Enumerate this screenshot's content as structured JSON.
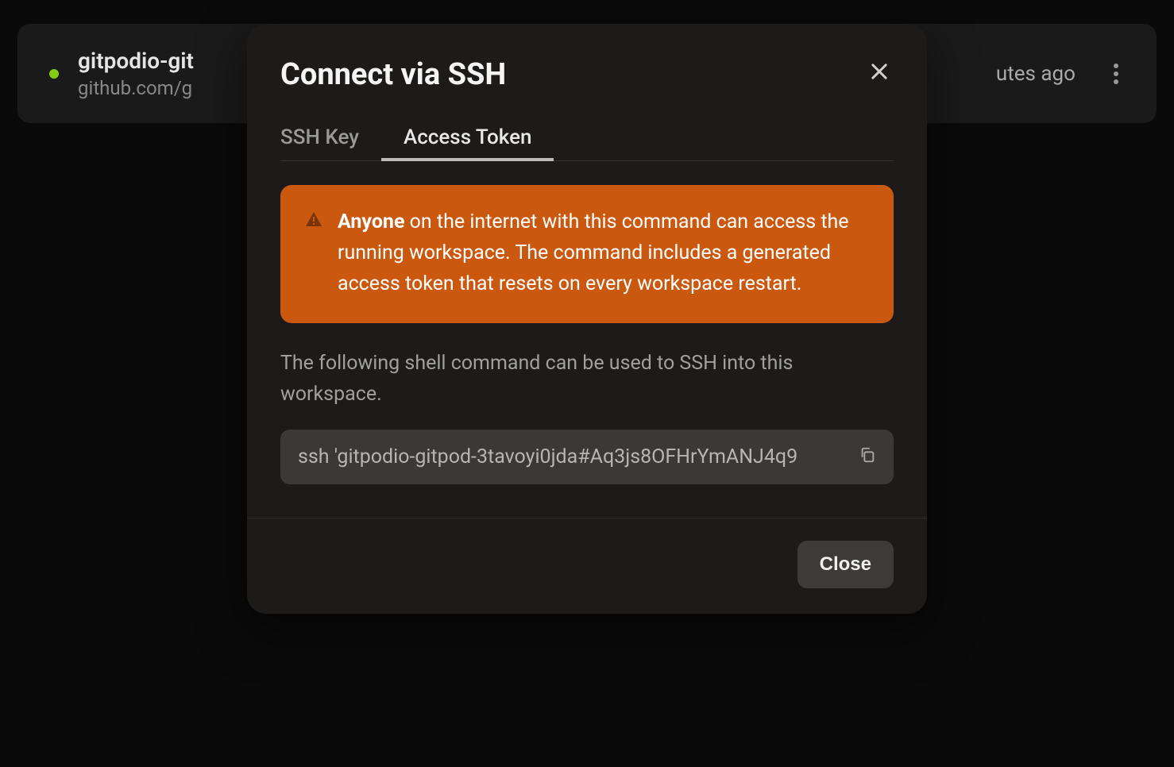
{
  "workspace": {
    "title": "gitpodio-git",
    "subtitle": "github.com/g",
    "time": "utes ago"
  },
  "modal": {
    "title": "Connect via SSH",
    "tabs": {
      "ssh_key": "SSH Key",
      "access_token": "Access Token"
    },
    "warning": {
      "bold": "Anyone",
      "rest": " on the internet with this command can access the running workspace. The command includes a generated access token that resets on every workspace restart."
    },
    "description": "The following shell command can be used to SSH into this workspace.",
    "command": "ssh 'gitpodio-gitpod-3tavoyi0jda#Aq3js8OFHrYmANJ4q9",
    "close_button": "Close"
  }
}
